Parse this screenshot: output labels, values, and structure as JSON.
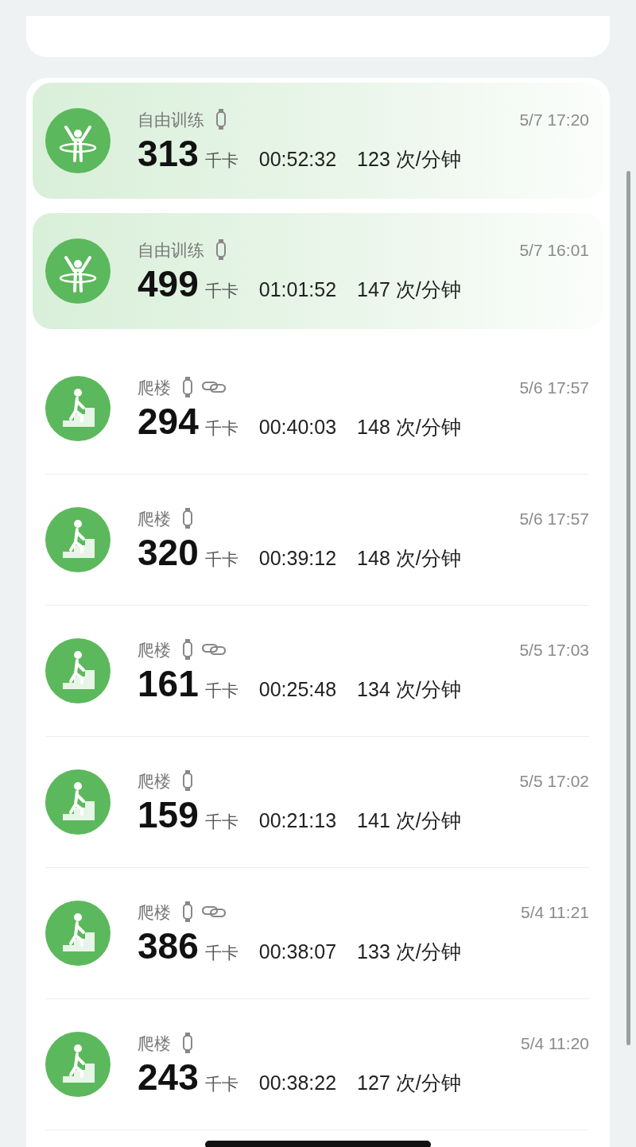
{
  "records": [
    {
      "kind": "freestyle",
      "title": "自由训练",
      "watch": true,
      "linked": false,
      "highlighted": true,
      "time": "5/7 17:20",
      "calories": "313",
      "unit": "千卡",
      "duration": "00:52:32",
      "heart_rate": "123 次/分钟"
    },
    {
      "kind": "freestyle",
      "title": "自由训练",
      "watch": true,
      "linked": false,
      "highlighted": true,
      "time": "5/7 16:01",
      "calories": "499",
      "unit": "千卡",
      "duration": "01:01:52",
      "heart_rate": "147 次/分钟"
    },
    {
      "kind": "stairs",
      "title": "爬楼",
      "watch": true,
      "linked": true,
      "highlighted": false,
      "time": "5/6 17:57",
      "calories": "294",
      "unit": "千卡",
      "duration": "00:40:03",
      "heart_rate": "148 次/分钟"
    },
    {
      "kind": "stairs",
      "title": "爬楼",
      "watch": true,
      "linked": false,
      "highlighted": false,
      "time": "5/6 17:57",
      "calories": "320",
      "unit": "千卡",
      "duration": "00:39:12",
      "heart_rate": "148 次/分钟"
    },
    {
      "kind": "stairs",
      "title": "爬楼",
      "watch": true,
      "linked": true,
      "highlighted": false,
      "time": "5/5 17:03",
      "calories": "161",
      "unit": "千卡",
      "duration": "00:25:48",
      "heart_rate": "134 次/分钟"
    },
    {
      "kind": "stairs",
      "title": "爬楼",
      "watch": true,
      "linked": false,
      "highlighted": false,
      "time": "5/5 17:02",
      "calories": "159",
      "unit": "千卡",
      "duration": "00:21:13",
      "heart_rate": "141 次/分钟"
    },
    {
      "kind": "stairs",
      "title": "爬楼",
      "watch": true,
      "linked": true,
      "highlighted": false,
      "time": "5/4 11:21",
      "calories": "386",
      "unit": "千卡",
      "duration": "00:38:07",
      "heart_rate": "133 次/分钟"
    },
    {
      "kind": "stairs",
      "title": "爬楼",
      "watch": true,
      "linked": false,
      "highlighted": false,
      "time": "5/4 11:20",
      "calories": "243",
      "unit": "千卡",
      "duration": "00:38:22",
      "heart_rate": "127 次/分钟"
    }
  ]
}
